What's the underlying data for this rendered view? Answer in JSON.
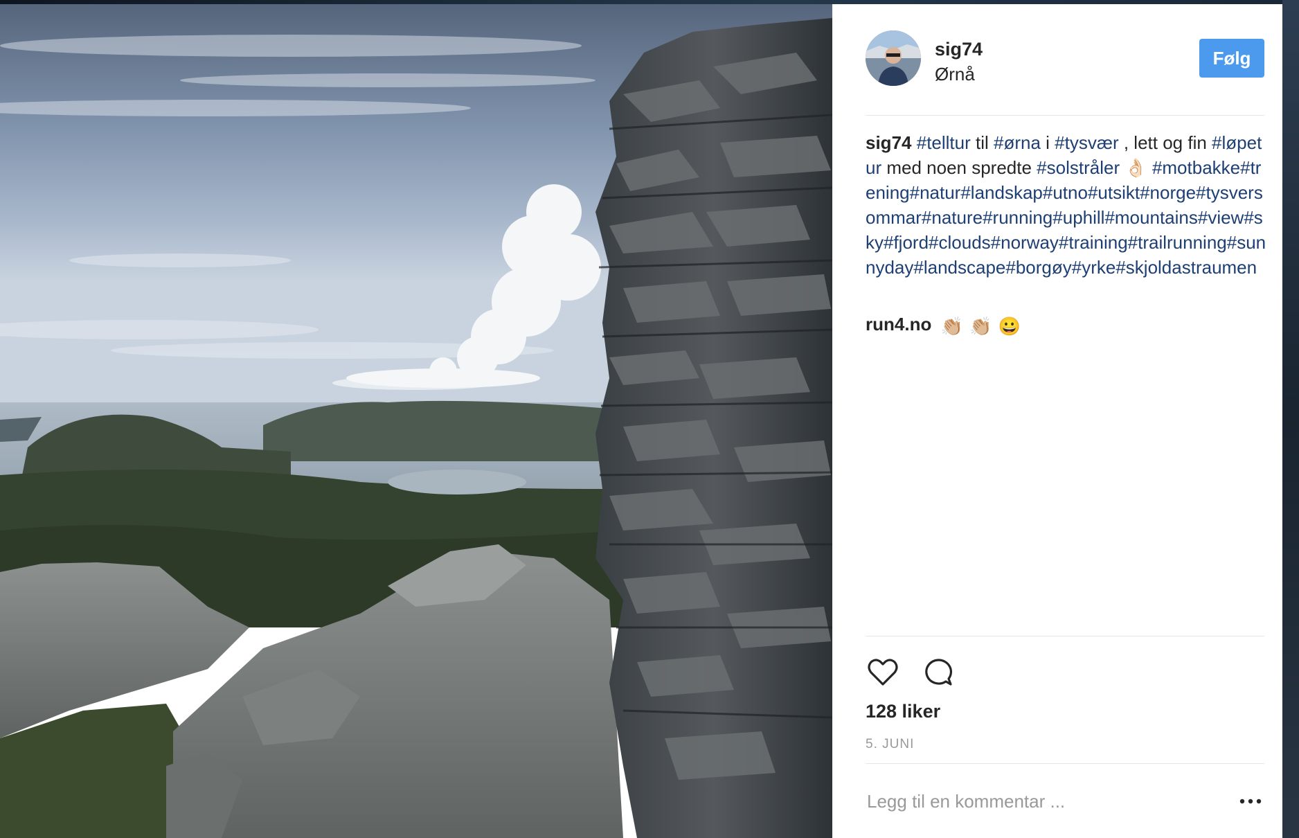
{
  "post": {
    "username": "sig74",
    "location": "Ørnå",
    "follow_label": "Følg",
    "caption": {
      "username": "sig74",
      "segments": [
        {
          "t": "tag",
          "v": "#telltur"
        },
        {
          "t": "text",
          "v": " til "
        },
        {
          "t": "tag",
          "v": "#ørna"
        },
        {
          "t": "text",
          "v": " i "
        },
        {
          "t": "tag",
          "v": "#tysvær"
        },
        {
          "t": "text",
          "v": " , lett og fin "
        },
        {
          "t": "tag",
          "v": "#løpetur"
        },
        {
          "t": "text",
          "v": " med noen spredte "
        },
        {
          "t": "tag",
          "v": "#solstråler"
        },
        {
          "t": "text",
          "v": " 👌🏻 "
        },
        {
          "t": "tag",
          "v": "#motbakke#trening#natur#landskap#utno#utsikt#norge#tysversommar#nature#running#uphill#mountains#view#sky#fjord#clouds#norway#training#trailrunning#sunnyday#landscape#borgøy#yrke#skjoldastraumen"
        }
      ]
    },
    "comment": {
      "username": "run4.no",
      "emojis": [
        "👏🏼",
        "👏🏼",
        "😀"
      ]
    },
    "likes_text": "128 liker",
    "date_text": "5. JUNI",
    "comment_placeholder": "Legg til en kommentar ...",
    "icons": {
      "like": "heart-icon",
      "comment": "speech-bubble-icon",
      "more": "more-options-icon"
    },
    "colors": {
      "follow_button": "#4c9aed",
      "hashtag": "#1e3f73",
      "muted": "#999999"
    }
  }
}
